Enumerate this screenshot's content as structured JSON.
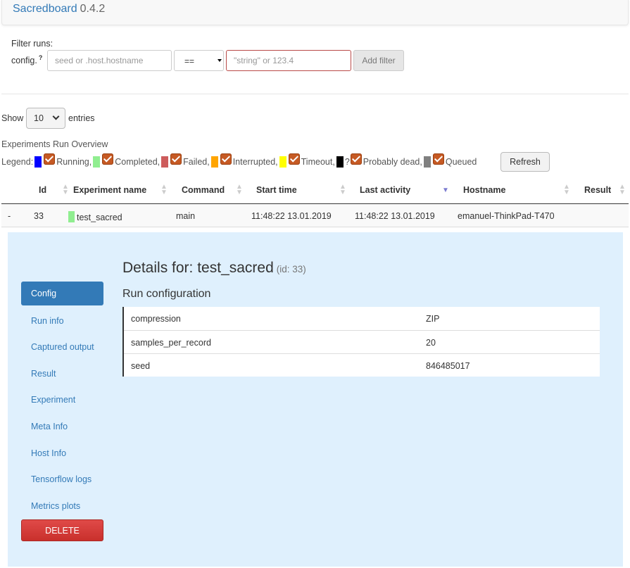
{
  "app": {
    "name": "Sacredboard",
    "version": "0.4.2"
  },
  "filter": {
    "title": "Filter runs:",
    "config_label": "config.",
    "help_mark": "?",
    "key_placeholder": "seed or .host.hostname",
    "operator": "==",
    "value_placeholder": "\"string\" or 123.4",
    "add_label": "Add filter"
  },
  "entries": {
    "show": "Show",
    "count": "10",
    "suffix": "entries"
  },
  "overview": {
    "title": "Experiments Run Overview",
    "legend_label": "Legend:",
    "items": [
      {
        "label": "Running,",
        "color": "#0000ff"
      },
      {
        "label": "Completed,",
        "color": "#90ee90"
      },
      {
        "label": "Failed,",
        "color": "#cd5c5c"
      },
      {
        "label": "Interrupted,",
        "color": "#ffa500"
      },
      {
        "label": "Timeout,",
        "color": "#ffff00"
      },
      {
        "label": "Probably dead,",
        "color": "#000000",
        "prefix": "?"
      },
      {
        "label": "Queued",
        "color": "#808080"
      }
    ],
    "refresh_label": "Refresh"
  },
  "table": {
    "columns": [
      "Id",
      "Experiment name",
      "Command",
      "Start time",
      "Last activity",
      "Hostname",
      "Result"
    ],
    "rows": [
      {
        "toggle": "-",
        "id": "33",
        "name": "test_sacred",
        "status_color": "#90ee90",
        "command": "main",
        "start": "11:48:22 13.01.2019",
        "last": "11:48:22 13.01.2019",
        "host": "emanuel-ThinkPad-T470",
        "result": ""
      }
    ]
  },
  "details": {
    "title_prefix": "Details for:",
    "name": "test_sacred",
    "id_text": "(id: 33)",
    "section_title": "Run configuration",
    "config": [
      {
        "key": "compression",
        "value": "ZIP"
      },
      {
        "key": "samples_per_record",
        "value": "20"
      },
      {
        "key": "seed",
        "value": "846485017"
      }
    ],
    "nav": [
      "Config",
      "Run info",
      "Captured output",
      "Result",
      "Experiment",
      "Meta Info",
      "Host Info",
      "Tensorflow logs",
      "Metrics plots"
    ],
    "active_nav": "Config",
    "delete_label": "DELETE"
  }
}
